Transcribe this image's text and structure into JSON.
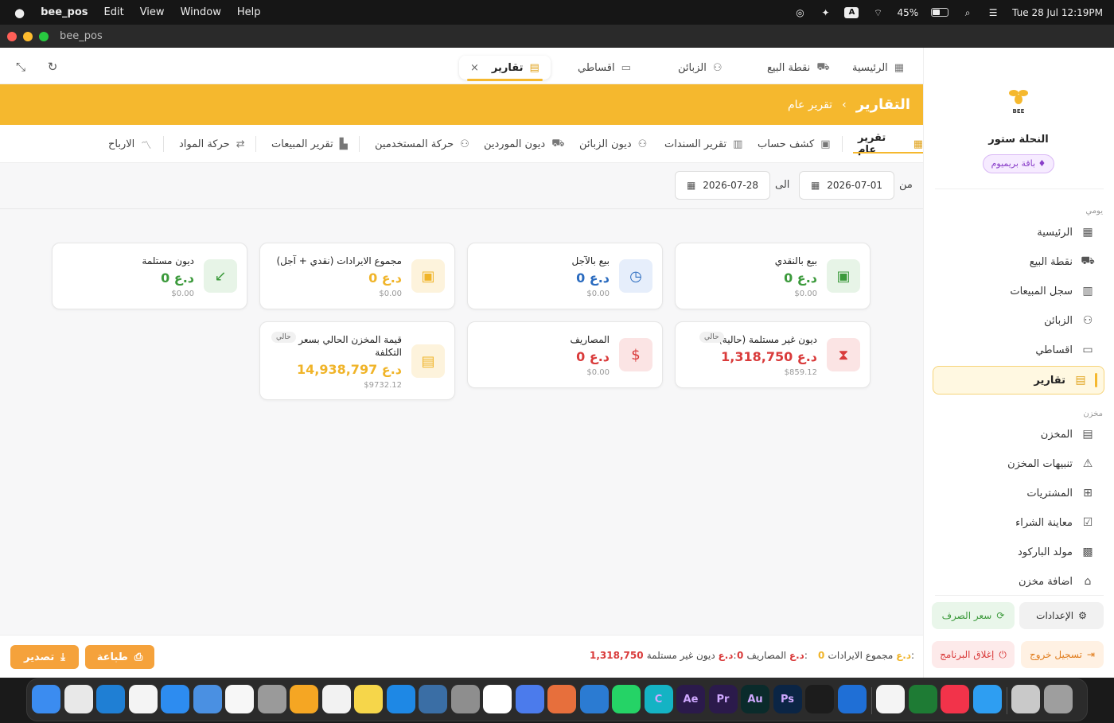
{
  "menubar": {
    "app": "bee_pos",
    "menus": [
      "Edit",
      "View",
      "Window",
      "Help"
    ],
    "battery": "45%",
    "input_source": "A",
    "datetime": "Tue 28 Jul  12:19PM"
  },
  "window": {
    "title": "bee_pos"
  },
  "topnav": {
    "items": [
      {
        "label": "الرئيسية",
        "icon": "grid-icon"
      },
      {
        "label": "نقطة البيع",
        "icon": "cart-icon"
      },
      {
        "label": "الزبائن",
        "icon": "users-icon"
      },
      {
        "label": "اقساطي",
        "icon": "card-icon"
      },
      {
        "label": "تقارير",
        "icon": "chart-icon"
      }
    ],
    "close": "×"
  },
  "banner": {
    "title": "التقارير",
    "separator": "‹",
    "current": "تقرير عام"
  },
  "subtabs": [
    {
      "label": "تقرير عام"
    },
    {
      "label": "كشف حساب"
    },
    {
      "label": "تقرير السندات"
    },
    {
      "label": "ديون الزبائن"
    },
    {
      "label": "ديون الموردين"
    },
    {
      "label": "حركة المستخدمين"
    },
    {
      "label": "تقرير المبيعات"
    },
    {
      "label": "حركة المواد"
    },
    {
      "label": "الارباح"
    }
  ],
  "filter": {
    "from_label": "من",
    "from_date": "2026-07-01",
    "to_label": "الى",
    "to_date": "2026-07-28"
  },
  "cards": [
    {
      "title": "بيع بالنقدي",
      "value": "0 د.ع",
      "usd": "$0.00",
      "color": "#3c9a3c"
    },
    {
      "title": "بيع بالآجل",
      "value": "0 د.ع",
      "usd": "$0.00",
      "color": "#2a6bbf"
    },
    {
      "title": "مجموع الايرادات (نقدي + آجل)",
      "value": "0 د.ع",
      "usd": "$0.00",
      "color": "#f0b429"
    },
    {
      "title": "ديون مستلمة",
      "value": "0 د.ع",
      "usd": "$0.00",
      "color": "#3c9a3c"
    },
    {
      "title": "ديون غير مستلمة (حالية)",
      "value": "1,318,750 د.ع",
      "usd": "$859.12",
      "tag": "حالي",
      "color": "#d93b3b"
    },
    {
      "title": "المصاريف",
      "value": "0 د.ع",
      "usd": "$0.00",
      "color": "#d93b3b"
    },
    {
      "title": "قيمة المخزن الحالي بسعر التكلفة",
      "value": "14,938,797 د.ع",
      "usd": "$9732.12",
      "tag": "حالي",
      "color": "#f0b429"
    }
  ],
  "footer": {
    "export": "تصدير",
    "print": "طباعة",
    "sum_rev_label": "مجموع الايرادات:",
    "sum_rev_value": "0 د.ع",
    "exp_label": "المصاريف:",
    "exp_value": "0 د.ع",
    "debt_label": "ديون غير مستلمة:",
    "debt_value": "1,318,750 د.ع"
  },
  "sidebar": {
    "logo_text": "BEE",
    "store_name": "النحلة ستور",
    "badge": "باقة بريميوم",
    "section_daily": "يومي",
    "section_store": "مخزن",
    "daily_items": [
      {
        "label": "الرئيسية"
      },
      {
        "label": "نقطة البيع"
      },
      {
        "label": "سجل المبيعات"
      },
      {
        "label": "الزبائن"
      },
      {
        "label": "اقساطي"
      },
      {
        "label": "تقارير"
      }
    ],
    "store_items": [
      {
        "label": "المخزن"
      },
      {
        "label": "تنبيهات المخزن"
      },
      {
        "label": "المشتريات"
      },
      {
        "label": "معاينة الشراء"
      },
      {
        "label": "مولد الباركود"
      },
      {
        "label": "اضافة مخزن"
      }
    ],
    "settings": "الإعدادات",
    "exchange": "سعر الصرف",
    "logout": "تسجيل خروج",
    "close_app": "إغلاق البرنامج"
  },
  "dock": [
    "Finder",
    "Launchpad",
    "Edge",
    "Chrome",
    "Safari",
    "Mail",
    "Photos",
    "Contacts",
    "Pages",
    "Reminders",
    "Notes",
    "App Store",
    "Simulator",
    "Settings",
    "ChatGPT",
    "Gemini",
    "Claude",
    "VS Code",
    "WhatsApp",
    "Canva",
    "Ae",
    "Pr",
    "Au",
    "Ps",
    "DaVinci",
    "QuickTime",
    "Preview",
    "Numbers",
    "Music",
    "Flutter",
    "Finder Files",
    "Trash"
  ]
}
